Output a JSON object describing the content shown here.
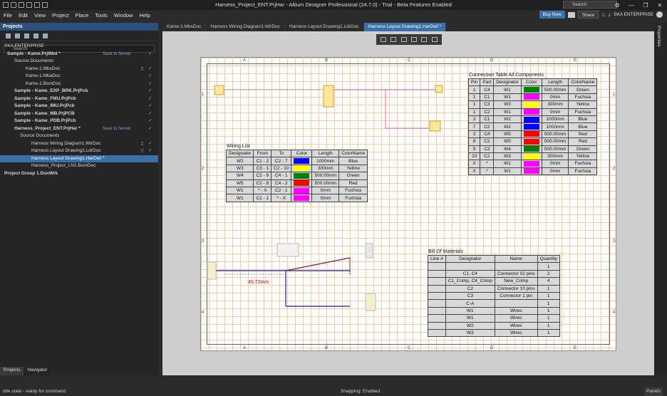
{
  "window": {
    "title": "Harness_Project_ENT.PrjHar - Altium Designer Professional (24.7.0) - Trial - Beta Features Enabled",
    "search_placeholder": "Search"
  },
  "menu": [
    "File",
    "Edit",
    "View",
    "Project",
    "Place",
    "Tools",
    "Window",
    "Help"
  ],
  "topright": {
    "buy_now": "Buy Now",
    "share": "Share",
    "enterprise": "SKA ENTERPRISE"
  },
  "panel": {
    "title": "Projects",
    "search_placeholder": "Search",
    "tabs": [
      "Projects",
      "Navigator"
    ],
    "tree": [
      {
        "label": "SKA ENTERPRISE",
        "indent": 6,
        "bold": false
      },
      {
        "label": "Sample - Kame.PrjMbd *",
        "indent": 10,
        "bold": true,
        "s2s": "Save to Server",
        "check": true
      },
      {
        "label": "Source Documents",
        "indent": 20,
        "bold": false
      },
      {
        "label": "Kame-1.MbsDoc",
        "indent": 36,
        "bold": false,
        "check": true,
        "doc": true
      },
      {
        "label": "Kame-1.MbaDoc",
        "indent": 36,
        "bold": false,
        "check": true
      },
      {
        "label": "Kame-1.BomDoc",
        "indent": 36,
        "bold": false,
        "check": true
      },
      {
        "label": "Sample - Kame_EXP_BRK.PrjPcb",
        "indent": 20,
        "bold": true,
        "check": true
      },
      {
        "label": "Sample - Kame_FMU.PrjPcb",
        "indent": 20,
        "bold": true,
        "check": true
      },
      {
        "label": "Sample - Kame_IMU.PrjPcb",
        "indent": 20,
        "bold": true,
        "check": true
      },
      {
        "label": "Sample - Kame_MB.PrjPCB",
        "indent": 20,
        "bold": true,
        "check": true
      },
      {
        "label": "Sample - Kame_PDB.PrjPcb",
        "indent": 20,
        "bold": true,
        "check": true
      },
      {
        "label": "Harness_Project_ENT.PrjHar *",
        "indent": 20,
        "bold": true,
        "s2s": "Save to Server",
        "check": true
      },
      {
        "label": "Source Documents",
        "indent": 28,
        "bold": false
      },
      {
        "label": "Harness Wiring Diagram1.WirDoc",
        "indent": 44,
        "bold": false,
        "check": true,
        "doc": true
      },
      {
        "label": "Harness Layout Drawing1.LdrDoc",
        "indent": 44,
        "bold": false,
        "check": true,
        "doc": true
      },
      {
        "label": "Harness Layout Drawing1.HarDwf *",
        "indent": 44,
        "bold": false,
        "selected": true
      },
      {
        "label": "Harness_Project_LN1.BomDoc",
        "indent": 44,
        "bold": false
      },
      {
        "label": "Project Group 1.DsnWrk",
        "indent": 6,
        "bold": true
      }
    ]
  },
  "doc_tabs": [
    {
      "label": "Kame-1.MbsDoc",
      "active": false
    },
    {
      "label": "Harness Wiring Diagram1.WirDoc",
      "active": false
    },
    {
      "label": "Harness Layout Drawing1.LdrDoc",
      "active": false
    },
    {
      "label": "Harness Layout Drawing1.HarDwf *",
      "active": true
    }
  ],
  "right_rail": "Properties",
  "status": {
    "left": "Idle state - ready for command",
    "center": "Snapping: Enabled",
    "right": "Panels"
  },
  "sheet": {
    "zones_top": [
      "A",
      "B",
      "C",
      "D",
      "E"
    ],
    "zones_side": [
      "1",
      "2",
      "3",
      "4"
    ],
    "dimension": "45.72mm",
    "wiring_list": {
      "title": "Wiring List",
      "headers": [
        "Designator",
        "From",
        "To",
        "Color",
        "Length",
        "ColorName"
      ],
      "rows": [
        [
          "W2",
          "C1 - 2",
          "C2 - 7",
          "#0000ff",
          "1000mm",
          "Blue"
        ],
        [
          "W3",
          "C3 - 1",
          "C2 - 10",
          "#ffff00",
          "300mm",
          "Yellow"
        ],
        [
          "W4",
          "C2 - 9",
          "C4 - 1",
          "#008000",
          "500.00mm",
          "Green"
        ],
        [
          "W5",
          "C2 - 8",
          "C4 - 2",
          "#ff0000",
          "500.00mm",
          "Red"
        ],
        [
          "W1",
          "* - X",
          "C2 - 1",
          "#ff00ff",
          "0mm",
          "Fuchsia"
        ],
        [
          "W1",
          "C1 - 1",
          "* - X",
          "#ff00ff",
          "0mm",
          "Fuchsia"
        ]
      ]
    },
    "connection_table": {
      "title": "Connection Table All Components",
      "headers": [
        "Pin",
        "Part",
        "Designator",
        "Color",
        "Length",
        "ColorName"
      ],
      "rows": [
        [
          "1",
          "C4",
          "W1",
          "#008000",
          "500.00mm",
          "Green"
        ],
        [
          "1",
          "C1",
          "W1",
          "#ff00ff",
          "0mm",
          "Fuchsia"
        ],
        [
          "1",
          "C3",
          "W3",
          "#ffff00",
          "300mm",
          "Yellow"
        ],
        [
          "1",
          "C2",
          "W1",
          "#ff00ff",
          "0mm",
          "Fuchsia"
        ],
        [
          "2",
          "C1",
          "W2",
          "#0000ff",
          "1000mm",
          "Blue"
        ],
        [
          "7",
          "C2",
          "W2",
          "#0000ff",
          "1000mm",
          "Blue"
        ],
        [
          "2",
          "C4",
          "W5",
          "#ff0000",
          "500.00mm",
          "Red"
        ],
        [
          "8",
          "C2",
          "W5",
          "#ff0000",
          "500.00mm",
          "Red"
        ],
        [
          "9",
          "C2",
          "W4",
          "#008000",
          "500.00mm",
          "Green"
        ],
        [
          "10",
          "C2",
          "W3",
          "#ffff00",
          "300mm",
          "Yellow"
        ],
        [
          "X",
          "*",
          "W1",
          "#ff00ff",
          "0mm",
          "Fuchsia"
        ],
        [
          "X",
          "*",
          "W1",
          "#ff00ff",
          "0mm",
          "Fuchsia"
        ]
      ]
    },
    "bom": {
      "title": "Bill Of Materials",
      "headers": [
        "Line #",
        "Designator",
        "Name",
        "Quantity"
      ],
      "rows": [
        [
          "",
          "",
          "",
          "1"
        ],
        [
          "",
          "C1, C4",
          "Connector 02 pins",
          "2"
        ],
        [
          "",
          "C1_Crimp, C4_Crimp",
          "New_Crimp",
          "4"
        ],
        [
          "",
          "C2",
          "Connector 10 pins",
          "1"
        ],
        [
          "",
          "C3",
          "Connector 1 pin",
          "1"
        ],
        [
          "",
          "C-A",
          "",
          "1"
        ],
        [
          "",
          "W1",
          "Wires",
          "1"
        ],
        [
          "",
          "W1",
          "Wires",
          "1"
        ],
        [
          "",
          "W2",
          "Wires",
          "1"
        ],
        [
          "",
          "W3",
          "Wires",
          "1"
        ]
      ]
    }
  }
}
